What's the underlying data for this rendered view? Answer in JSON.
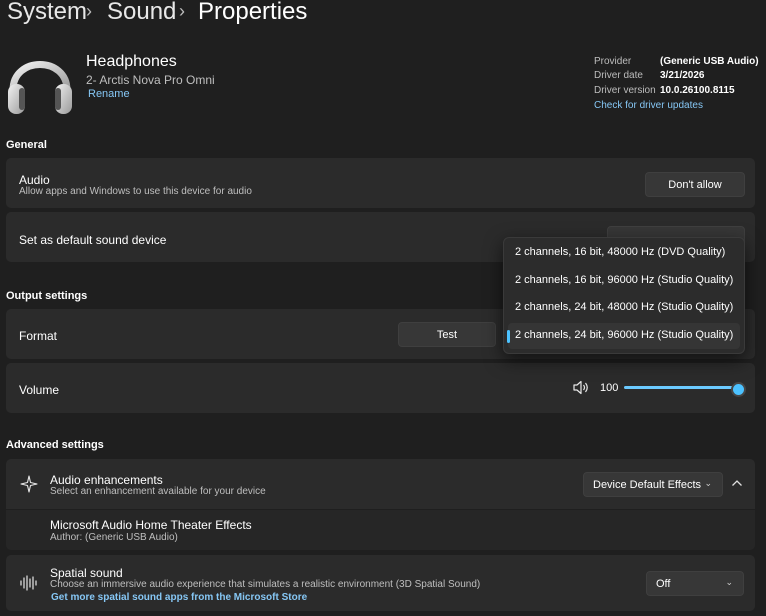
{
  "breadcrumb": {
    "items": [
      "System",
      "Sound",
      "Properties"
    ]
  },
  "device": {
    "name": "Headphones",
    "subtitle": "2- Arctis Nova Pro Omni",
    "rename_label": "Rename"
  },
  "driver": {
    "provider_label": "Provider",
    "provider_value": "(Generic USB Audio)",
    "date_label": "Driver date",
    "date_value": "3/21/2026",
    "version_label": "Driver version",
    "version_value": "10.0.26100.8115",
    "update_link": "Check for driver updates"
  },
  "general": {
    "heading": "General",
    "audio_title": "Audio",
    "audio_desc": "Allow apps and Windows to use this device for audio",
    "dont_allow_label": "Don't allow",
    "default_title": "Set as default sound device"
  },
  "output": {
    "heading": "Output settings",
    "format_title": "Format",
    "test_label": "Test",
    "format_options": [
      "2 channels, 16 bit, 48000 Hz (DVD Quality)",
      "2 channels, 16 bit, 96000 Hz (Studio Quality)",
      "2 channels, 24 bit, 48000 Hz (Studio Quality)",
      "2 channels, 24 bit, 96000 Hz (Studio Quality)"
    ],
    "selected_format_index": 3,
    "volume_title": "Volume",
    "volume_value": "100",
    "volume_fraction": 1.0
  },
  "advanced": {
    "heading": "Advanced settings",
    "enh_title": "Audio enhancements",
    "enh_desc": "Select an enhancement available for your device",
    "enh_value": "Device Default Effects",
    "effect_title": "Microsoft Audio Home Theater Effects",
    "effect_author": "Author: (Generic USB Audio)",
    "spatial_title": "Spatial sound",
    "spatial_desc": "Choose an immersive audio experience that simulates a realistic environment (3D Spatial Sound)",
    "spatial_link": "Get more spatial sound apps from the Microsoft Store",
    "spatial_value": "Off"
  },
  "colors": {
    "accent": "#4cc2ff",
    "link": "#86c7f5",
    "card": "#2b2b2b",
    "background": "#1f1f1f"
  }
}
